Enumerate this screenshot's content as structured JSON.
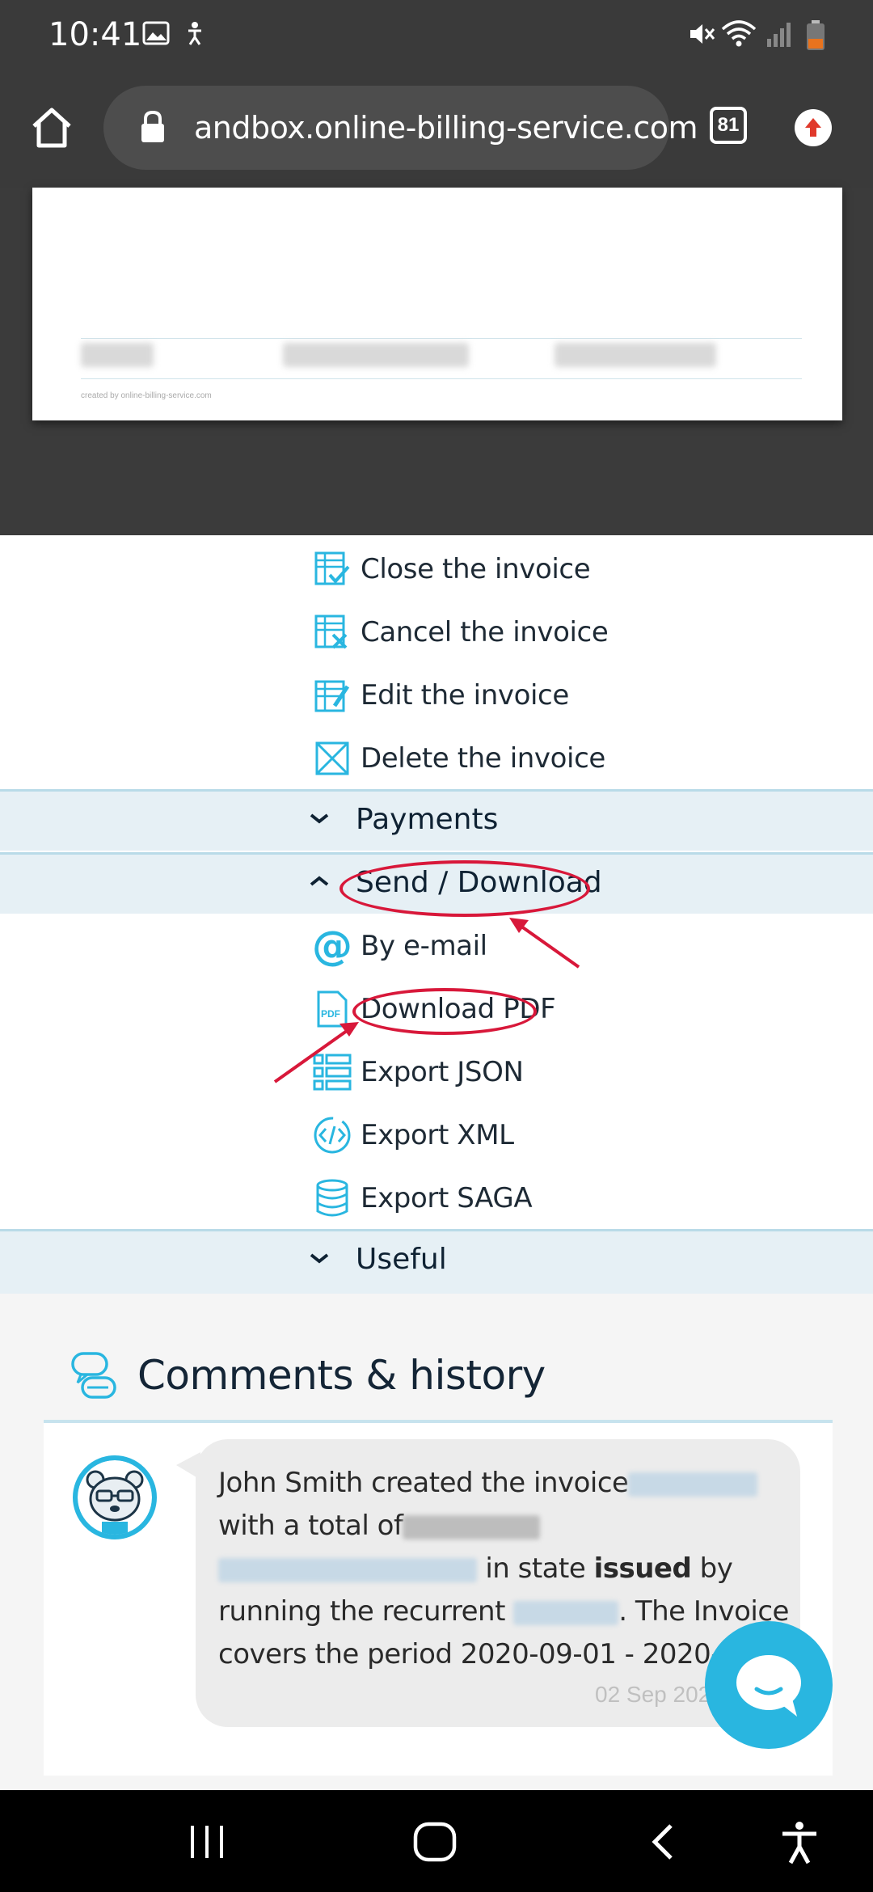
{
  "status_bar": {
    "time": "10:41"
  },
  "browser": {
    "url": "andbox.online-billing-service.com",
    "tab_count": "81"
  },
  "preview": {
    "created_by": "created by online-billing-service.com"
  },
  "invoice_actions": [
    {
      "label": "Close the invoice"
    },
    {
      "label": "Cancel the invoice"
    },
    {
      "label": "Edit the invoice"
    },
    {
      "label": "Delete the invoice"
    }
  ],
  "sections": {
    "payments": "Payments",
    "send_download": "Send / Download",
    "useful": "Useful"
  },
  "send_download_items": [
    {
      "label": "By e-mail",
      "icon": "at-icon"
    },
    {
      "label": "Download PDF",
      "icon": "pdf-icon"
    },
    {
      "label": "Export JSON",
      "icon": "list-icon"
    },
    {
      "label": "Export XML",
      "icon": "code-icon"
    },
    {
      "label": "Export SAGA",
      "icon": "database-icon"
    }
  ],
  "comments": {
    "title": "Comments & history",
    "entry": {
      "part1": "John Smith created the invoice",
      "part2": "with a total of",
      "part3": "in state",
      "state": "issued",
      "part4": "by running the recurrent",
      "part5": ". The Invoice covers the period 2020-09-01 - 2020-09-30",
      "date": "02 Sep 202"
    }
  },
  "colors": {
    "accent": "#29b6e0",
    "annotation": "#d8183a",
    "section_bg": "#e6f0f5"
  }
}
